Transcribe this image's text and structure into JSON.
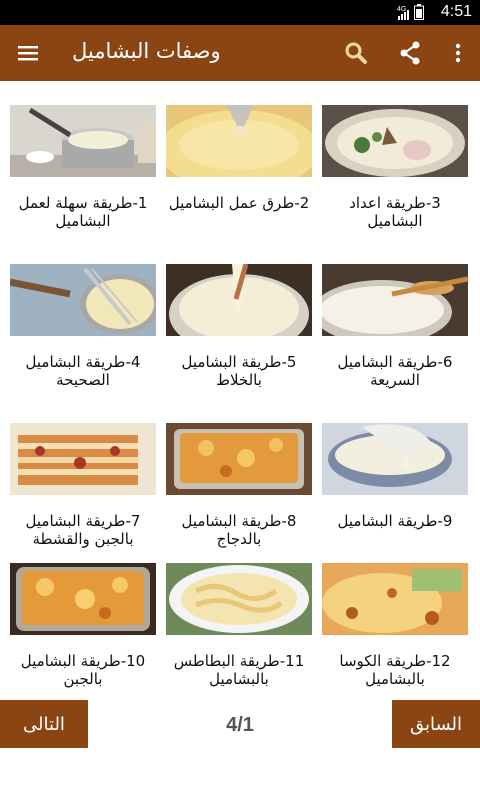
{
  "status": {
    "time": "4:51",
    "network": "4G"
  },
  "app": {
    "title": "وصفات البشاميل",
    "accent": "#8b4513"
  },
  "recipes": [
    {
      "label": "1-طريقة سهلة لعمل البشاميل",
      "image": "pot-of-sauce"
    },
    {
      "label": "2-طرق عمل البشاميل",
      "image": "sauce-in-pan-with-spoon"
    },
    {
      "label": "3-طريقة اعداد البشاميل",
      "image": "pan-with-herbs"
    },
    {
      "label": "4-طريقة البشاميل الصحيحة",
      "image": "pan-with-whisk"
    },
    {
      "label": "5-طريقة البشاميل بالخلاط",
      "image": "sauce-pouring"
    },
    {
      "label": "6-طريقة البشاميل السريعة",
      "image": "sauce-in-bowl-with-spoon"
    },
    {
      "label": "7-طريقة البشاميل بالجبن والقشطة",
      "image": "lasagna-slice"
    },
    {
      "label": "8-طريقة البشاميل بالدجاج",
      "image": "baked-casserole"
    },
    {
      "label": "9-طريقة البشاميل",
      "image": "bowl-of-sauce"
    },
    {
      "label": "10-طريقة البشاميل بالجبن",
      "image": "cheese-casserole"
    },
    {
      "label": "11-طريقة البطاطس بالبشاميل",
      "image": "potato-gratin"
    },
    {
      "label": "12-طريقة الكوسا بالبشاميل",
      "image": "zucchini-bechamel"
    }
  ],
  "pagination": {
    "next_label": "التالى",
    "prev_label": "السابق",
    "indicator": "4/1"
  }
}
